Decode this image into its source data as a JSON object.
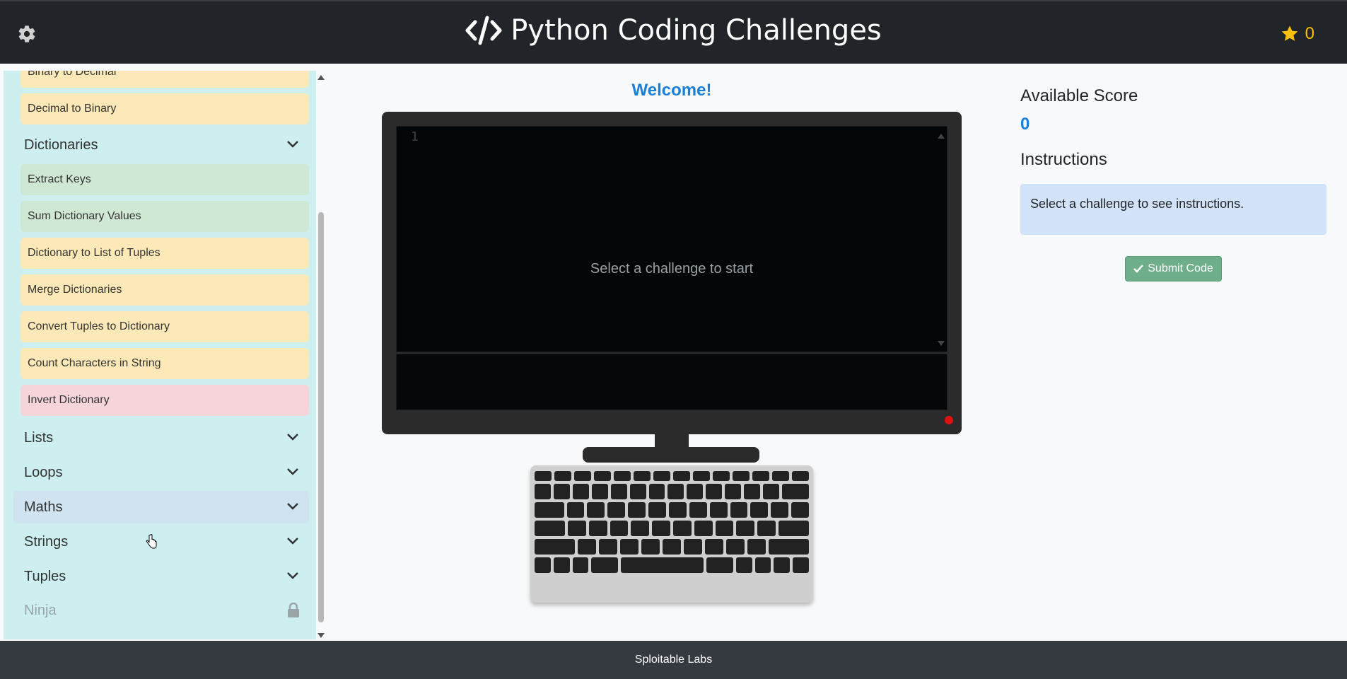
{
  "header": {
    "title": "Python Coding Challenges",
    "star_count": "0",
    "icons": [
      "gear-icon",
      "code-icon",
      "star-icon"
    ],
    "star_color": "#ffc107"
  },
  "sidebar": {
    "items_top": [
      {
        "label": "Binary to Decimal",
        "status": "yellow"
      },
      {
        "label": "Decimal to Binary",
        "status": "yellow"
      }
    ],
    "open_category": "Dictionaries",
    "dictionary_items": [
      {
        "label": "Extract Keys",
        "status": "green"
      },
      {
        "label": "Sum Dictionary Values",
        "status": "green"
      },
      {
        "label": "Dictionary to List of Tuples",
        "status": "yellow"
      },
      {
        "label": "Merge Dictionaries",
        "status": "yellow"
      },
      {
        "label": "Convert Tuples to Dictionary",
        "status": "yellow"
      },
      {
        "label": "Count Characters in String",
        "status": "yellow"
      },
      {
        "label": "Invert Dictionary",
        "status": "red"
      }
    ],
    "categories": [
      "Lists",
      "Loops",
      "Maths",
      "Strings",
      "Tuples"
    ],
    "locked_category": "Ninja"
  },
  "editor": {
    "welcome": "Welcome!",
    "line_number": "1",
    "placeholder": "Select a challenge to start"
  },
  "right": {
    "available_score_label": "Available Score",
    "available_score_value": "0",
    "instructions_label": "Instructions",
    "instructions_text": "Select a challenge to see instructions.",
    "submit_label": "Submit Code"
  },
  "footer": {
    "text": "Sploitable Labs"
  },
  "colors": {
    "accent": "#1a7fd8",
    "yellow": "#fde9b8",
    "green": "#cfe8d4",
    "red": "#f6d5da",
    "submit": "#6fae8a"
  }
}
